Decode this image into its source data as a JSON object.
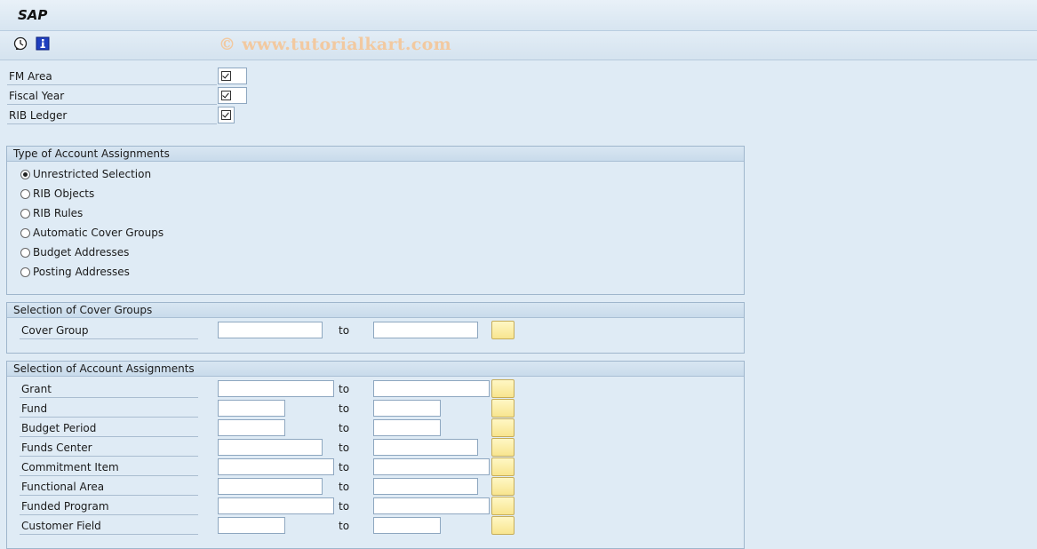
{
  "window": {
    "title": "SAP"
  },
  "toolbar": {
    "icons": [
      "execute-clock-icon",
      "info-icon"
    ],
    "watermark": "© www.tutorialkart.com"
  },
  "params": {
    "fm_area": {
      "label": "FM Area",
      "checked": true
    },
    "fiscal_year": {
      "label": "Fiscal Year",
      "checked": true
    },
    "rib_ledger": {
      "label": "RIB Ledger",
      "checked": true
    }
  },
  "type_frame": {
    "title": "Type of Account Assignments",
    "options": [
      {
        "label": "Unrestricted Selection",
        "selected": true
      },
      {
        "label": "RIB Objects",
        "selected": false
      },
      {
        "label": "RIB Rules",
        "selected": false
      },
      {
        "label": "Automatic Cover Groups",
        "selected": false
      },
      {
        "label": "Budget Addresses",
        "selected": false
      },
      {
        "label": "Posting Addresses",
        "selected": false
      }
    ]
  },
  "cover_frame": {
    "title": "Selection of Cover Groups",
    "rows": [
      {
        "label": "Cover Group",
        "to": "to",
        "from_value": "",
        "to_value": ""
      }
    ]
  },
  "assign_frame": {
    "title": "Selection of Account Assignments",
    "rows": [
      {
        "label": "Grant",
        "to": "to",
        "from_value": "",
        "to_value": ""
      },
      {
        "label": "Fund",
        "to": "to",
        "from_value": "",
        "to_value": ""
      },
      {
        "label": "Budget Period",
        "to": "to",
        "from_value": "",
        "to_value": ""
      },
      {
        "label": "Funds Center",
        "to": "to",
        "from_value": "",
        "to_value": ""
      },
      {
        "label": "Commitment Item",
        "to": "to",
        "from_value": "",
        "to_value": ""
      },
      {
        "label": "Functional Area",
        "to": "to",
        "from_value": "",
        "to_value": ""
      },
      {
        "label": "Funded Program",
        "to": "to",
        "from_value": "",
        "to_value": ""
      },
      {
        "label": "Customer Field",
        "to": "to",
        "from_value": "",
        "to_value": ""
      }
    ]
  },
  "colors": {
    "background": "#dfebf5",
    "multi_select_button": "#f8e58f"
  }
}
